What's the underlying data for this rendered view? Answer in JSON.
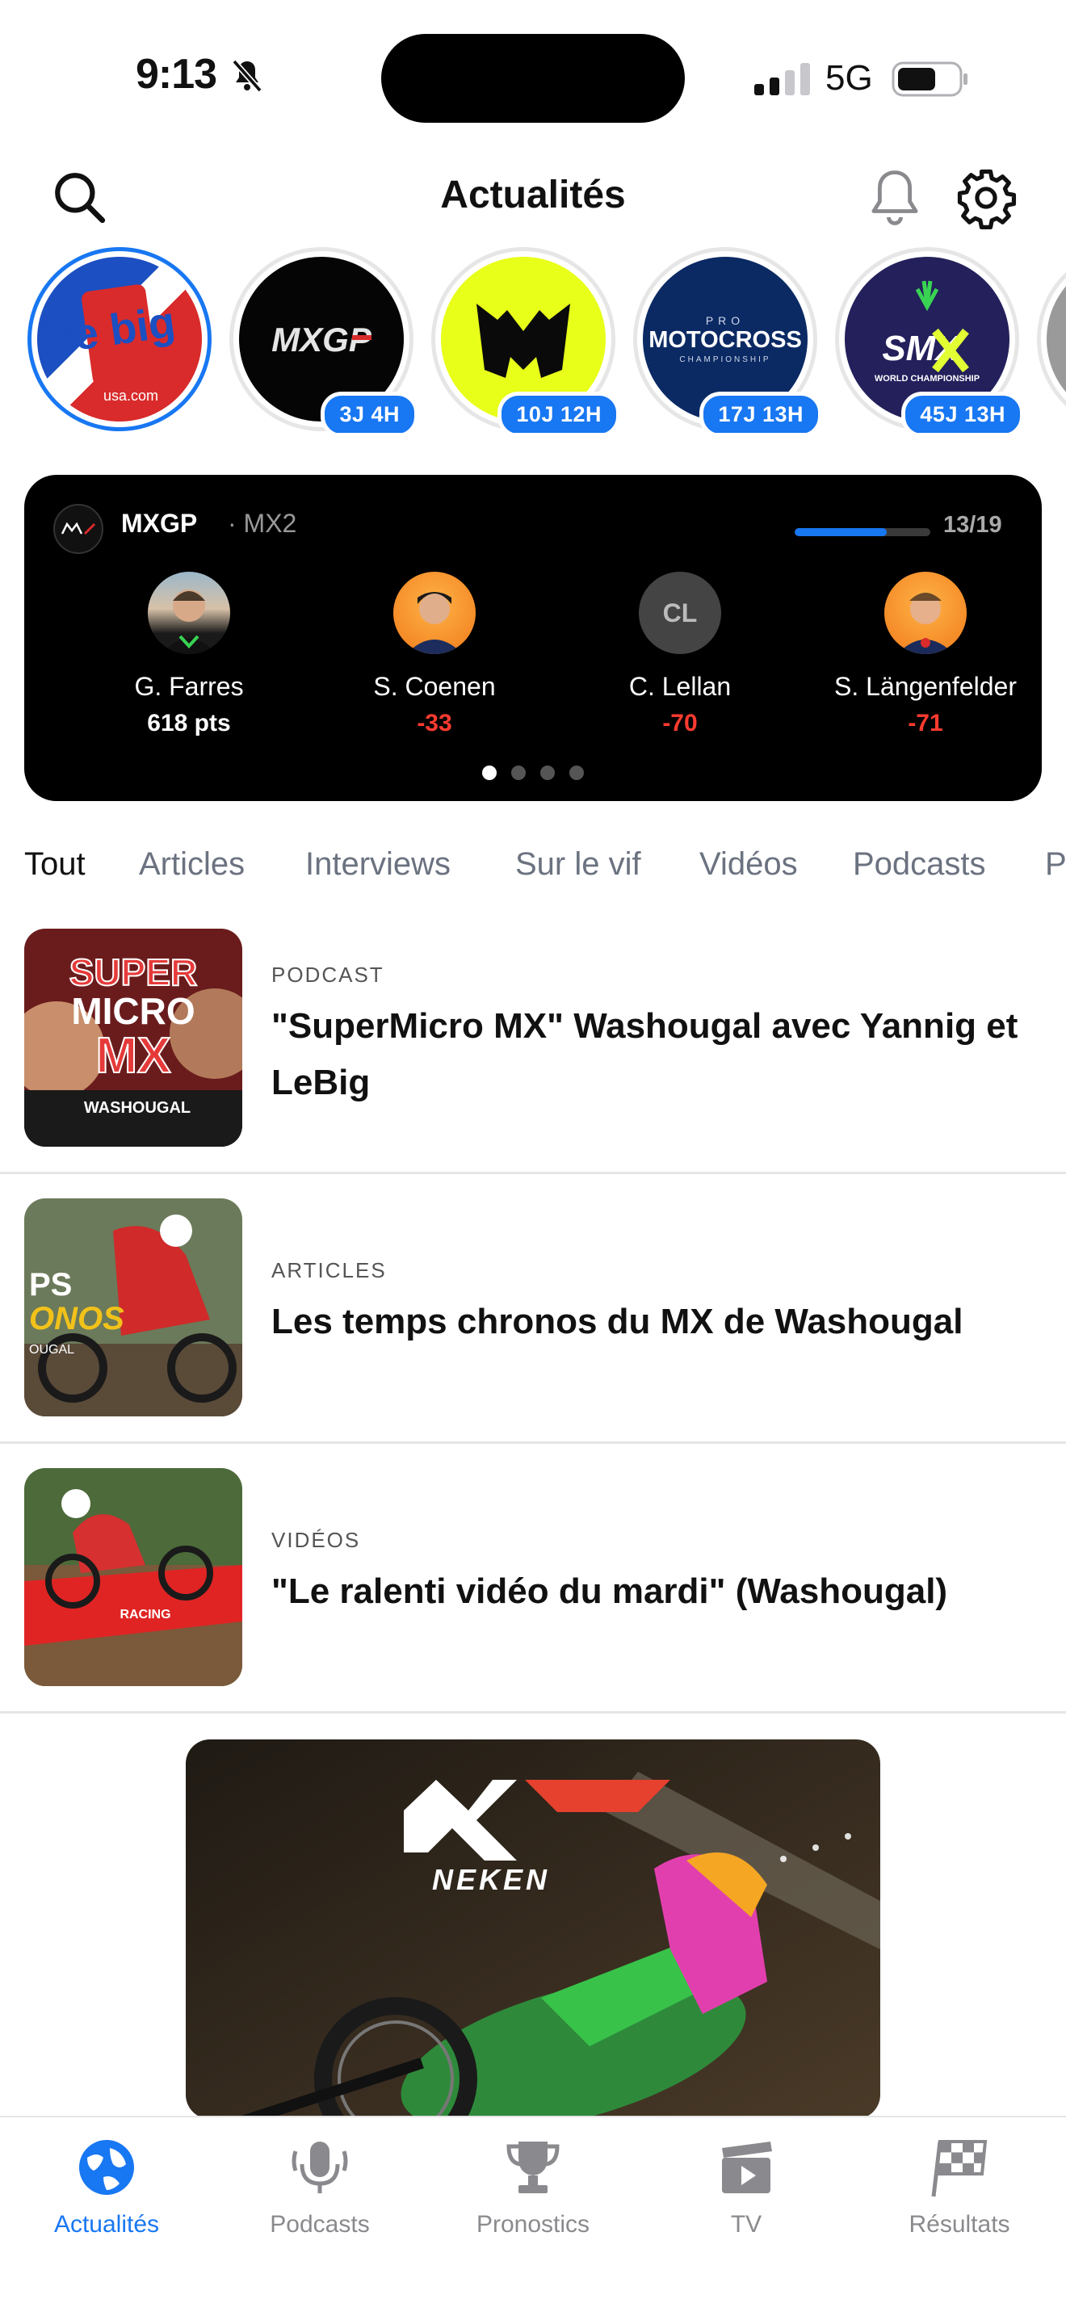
{
  "status_bar": {
    "time": "9:13",
    "network": "5G"
  },
  "header": {
    "title": "Actualités"
  },
  "stories": [
    {
      "name": "LeBig USA",
      "logo_text": "le big",
      "logo_sub": "usa.com",
      "badge": ""
    },
    {
      "name": "MXGP",
      "logo_text": "MXGP",
      "badge": "3J 4H"
    },
    {
      "name": "Supercross",
      "logo_text": "",
      "badge": "10J 12H"
    },
    {
      "name": "Pro Motocross",
      "logo_text": "MOTOCROSS",
      "logo_pre": "PRO",
      "logo_sub": "CHAMPIONSHIP",
      "badge": "17J 13H"
    },
    {
      "name": "SMX",
      "logo_text": "SMX",
      "logo_sub": "WORLD CHAMPIONSHIP",
      "badge": "45J 13H"
    }
  ],
  "standings": {
    "series": "MXGP",
    "separator": "·",
    "class": "MX2",
    "round": "13/19",
    "progress_fraction": 0.68,
    "riders": [
      {
        "name": "G. Farres",
        "points": "618 pts"
      },
      {
        "name": "S. Coenen",
        "points": "-33"
      },
      {
        "name": "C. Lellan",
        "points": "-70",
        "initials": "CL"
      },
      {
        "name": "S. Längenfelder",
        "points": "-71"
      }
    ],
    "page_count": 4,
    "active_page": 1
  },
  "filters": [
    "Tout",
    "Articles",
    "Interviews",
    "Sur le vif",
    "Vidéos",
    "Podcasts",
    "P"
  ],
  "news": [
    {
      "category": "PODCAST",
      "title": "\"SuperMicro MX\" Washougal avec Yannig et LeBig",
      "thumb_text": [
        "SUPER",
        "MICRO",
        "MX",
        "WASHOUGAL"
      ]
    },
    {
      "category": "ARTICLES",
      "title": "Les temps chronos du MX de Washougal",
      "thumb_text": [
        "PS",
        "ONOS",
        "OUGAL"
      ]
    },
    {
      "category": "VIDÉOS",
      "title": "\"Le ralenti vidéo du mardi\" (Washougal)",
      "thumb_text": [
        "RACING"
      ]
    }
  ],
  "ad": {
    "brand": "NEKEN"
  },
  "tabbar": [
    {
      "label": "Actualités",
      "icon": "globe-icon"
    },
    {
      "label": "Podcasts",
      "icon": "microphone-icon"
    },
    {
      "label": "Pronostics",
      "icon": "trophy-icon"
    },
    {
      "label": "TV",
      "icon": "tv-clapper-icon"
    },
    {
      "label": "Résultats",
      "icon": "checkered-flag-icon"
    }
  ],
  "colors": {
    "accent": "#1877f2",
    "negative": "#ff3b30"
  }
}
